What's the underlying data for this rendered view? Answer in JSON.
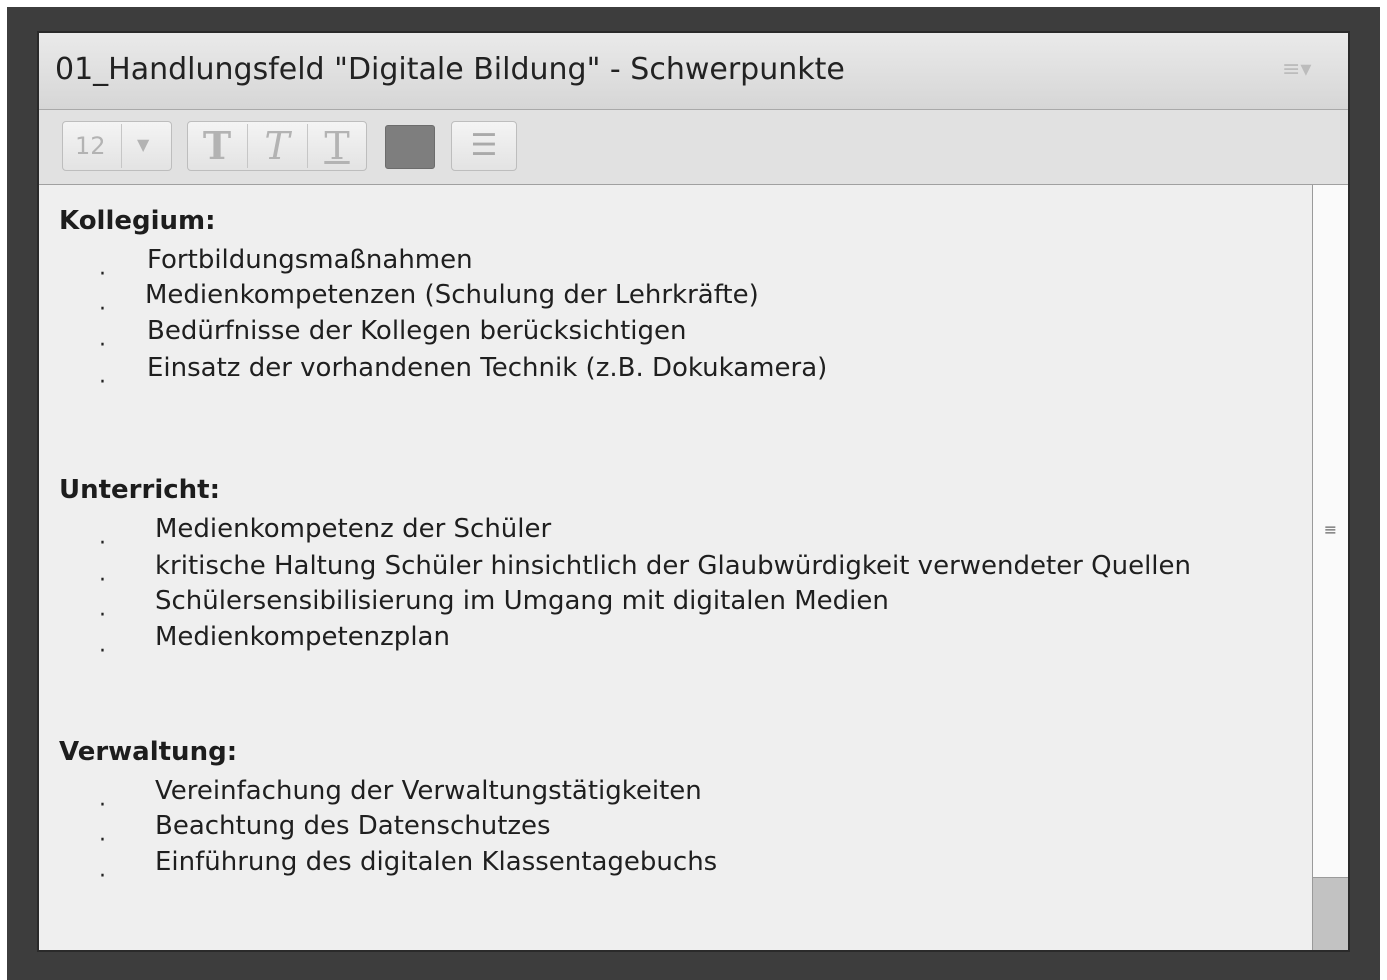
{
  "pod": {
    "title": "01_Handlungsfeld \"Digitale Bildung\" - Schwerpunkte",
    "menu_icon": "menu-icon"
  },
  "toolbar": {
    "font_size": "12",
    "bold_label": "T",
    "italic_label": "T",
    "underline_label": "T",
    "text_color": "#7e7e7e",
    "list_icon": "bulleted-list-icon"
  },
  "notes": {
    "bullet": "·",
    "sections": [
      {
        "heading": "Kollegium:",
        "items": [
          "Fortbildungsmaßnahmen",
          "Medienkompetenzen (Schulung der Lehrkräfte)",
          "Bedürfnisse der Kollegen berücksichtigen",
          "Einsatz der vorhandenen Technik (z.B. Dokukamera)"
        ]
      },
      {
        "heading": "Unterricht:",
        "items": [
          "Medienkompetenz der Schüler",
          "kritische Haltung Schüler hinsichtlich der Glaubwürdigkeit verwendeter Quellen",
          "Schülersensibilisierung im Umgang mit digitalen Medien",
          "Medienkompetenzplan"
        ]
      },
      {
        "heading": "Verwaltung:",
        "items": [
          "Vereinfachung der Verwaltungstätigkeiten",
          "Beachtung des Datenschutzes",
          "Einführung des digitalen Klassentagebuchs"
        ]
      }
    ]
  }
}
